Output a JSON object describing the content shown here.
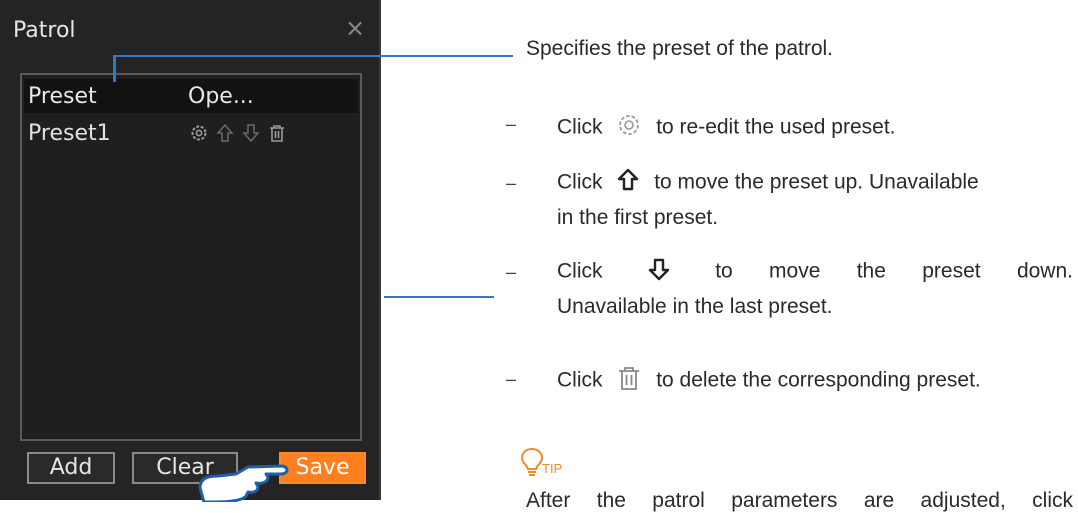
{
  "dialog": {
    "title": "Patrol",
    "close_glyph": "×",
    "columns": [
      "Preset",
      "Ope..."
    ],
    "rows": [
      {
        "name": "Preset1",
        "icons": [
          "gear-icon",
          "arrow-up-icon",
          "arrow-down-icon",
          "trash-icon"
        ]
      }
    ],
    "buttons": {
      "add": "Add",
      "clear": "Clear",
      "save": "Save"
    },
    "accent_color": "#ff7f1f",
    "callout_color": "#2e7ac8"
  },
  "annotations": {
    "preset_desc": "Specifies the preset of the patrol.",
    "items": [
      {
        "dash": "–",
        "click": "Click",
        "icon": "gear-icon",
        "text": "to re-edit the used preset."
      },
      {
        "dash": "–",
        "click": "Click",
        "icon": "arrow-up-icon",
        "text": "to move the preset up. Unavailable",
        "line2": "in the first preset."
      },
      {
        "dash": "–",
        "click": "Click",
        "icon": "arrow-down-icon",
        "text": "to move the preset down.",
        "line2": "Unavailable in the last preset."
      },
      {
        "dash": "–",
        "click": "Click",
        "icon": "trash-icon",
        "text": "to delete the corresponding preset."
      }
    ],
    "tip_label": "TIP",
    "tip_text": "After the patrol parameters are adjusted, click"
  }
}
